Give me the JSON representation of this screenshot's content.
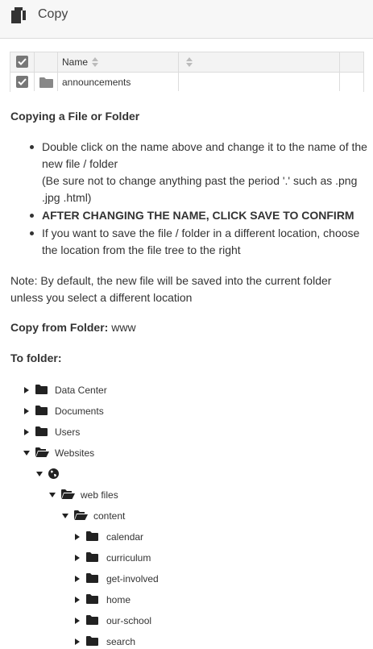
{
  "header": {
    "title": "Copy",
    "icon": "copy-icon"
  },
  "table": {
    "columns": [
      "Name",
      ""
    ],
    "rows": [
      {
        "name": "announcements",
        "checked": true
      }
    ]
  },
  "section_title": "Copying a File or Folder",
  "instructions": {
    "item1_line1": "Double click on the name above and change it to the name of the new file / folder",
    "item1_line2": "(Be sure not to change anything past the period '.' such as .png .jpg .html)",
    "item2": "AFTER CHANGING THE NAME, CLICK SAVE TO CONFIRM",
    "item3": "If you want to save the file / folder in a different location, choose the location from the file tree to the right"
  },
  "note": "Note: By default, the new file will be saved into the current folder unless you select a different location",
  "copy_from": {
    "label": "Copy from Folder:",
    "value": "www"
  },
  "to_folder_label": "To folder:",
  "tree": {
    "data_center": "Data Center",
    "documents": "Documents",
    "users": "Users",
    "websites": "Websites",
    "site": "",
    "web_files": "web files",
    "content": "content",
    "calendar": "calendar",
    "curriculum": "curriculum",
    "get_involved": "get-involved",
    "home": "home",
    "our_school": "our-school",
    "search": "search"
  }
}
